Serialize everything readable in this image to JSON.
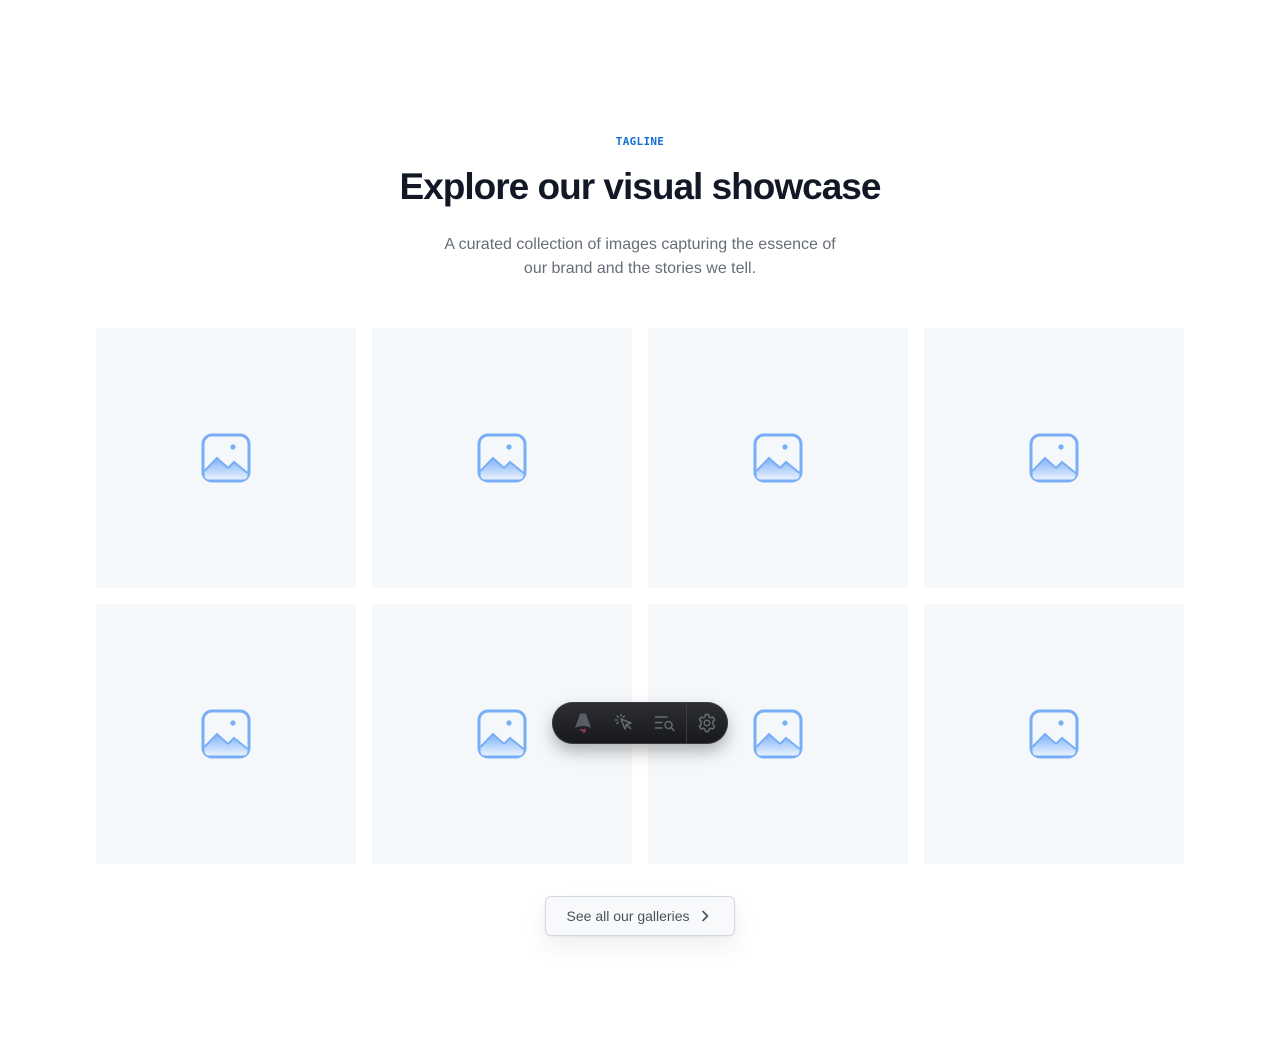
{
  "header": {
    "tagline": "TAGLINE",
    "title": "Explore our visual showcase",
    "subtitle": "A curated collection of images capturing the essence of our brand and the stories we tell."
  },
  "gallery": {
    "tiles": [
      {
        "icon": "image-placeholder-icon"
      },
      {
        "icon": "image-placeholder-icon"
      },
      {
        "icon": "image-placeholder-icon"
      },
      {
        "icon": "image-placeholder-icon"
      },
      {
        "icon": "image-placeholder-icon"
      },
      {
        "icon": "image-placeholder-icon"
      },
      {
        "icon": "image-placeholder-icon"
      },
      {
        "icon": "image-placeholder-icon"
      }
    ]
  },
  "cta": {
    "label": "See all our galleries",
    "icon": "chevron-right-icon"
  },
  "dev_toolbar": {
    "items": [
      {
        "icon": "astro-logo-icon"
      },
      {
        "icon": "cursor-inspect-icon"
      },
      {
        "icon": "audit-list-icon"
      },
      {
        "icon": "gear-icon"
      }
    ]
  },
  "colors": {
    "accent": "#1570d6",
    "heading": "#121826",
    "body_text": "#676d78",
    "tile_background": "#f5f8fb",
    "icon_blue": "#78aef5",
    "toolbar_background": "#1f2024"
  }
}
